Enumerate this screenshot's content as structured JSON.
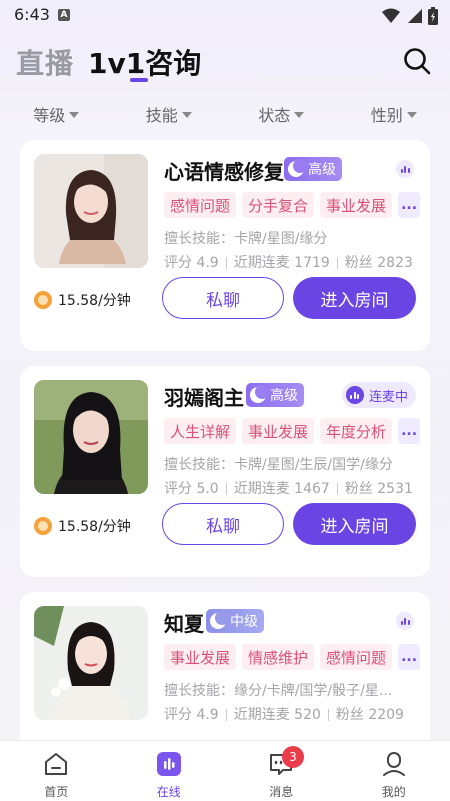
{
  "status_bar": {
    "time": "6:43",
    "notification_letter": "A"
  },
  "header": {
    "tab_live": "直播",
    "tab_1v1": "1v1咨询"
  },
  "filters": [
    {
      "label": "等级"
    },
    {
      "label": "技能"
    },
    {
      "label": "状态"
    },
    {
      "label": "性别"
    }
  ],
  "cards": [
    {
      "name": "心语情感修复",
      "level": "高级",
      "status": "idle",
      "tags": [
        "感情问题",
        "分手复合",
        "事业发展"
      ],
      "more": "...",
      "skills": "擅长技能：卡牌/星图/缘分",
      "score": "评分 4.9",
      "calls": "近期连麦 1719",
      "fans": "粉丝 2823",
      "price": "15.58/分钟",
      "chat_label": "私聊",
      "enter_label": "进入房间"
    },
    {
      "name": "羽嫣阁主",
      "level": "高级",
      "status": "live",
      "status_label": "连麦中",
      "tags": [
        "人生详解",
        "事业发展",
        "年度分析"
      ],
      "more": "...",
      "skills": "擅长技能：卡牌/星图/生辰/国学/缘分",
      "score": "评分 5.0",
      "calls": "近期连麦 1467",
      "fans": "粉丝 2531",
      "price": "15.58/分钟",
      "chat_label": "私聊",
      "enter_label": "进入房间"
    },
    {
      "name": "知夏",
      "level": "中级",
      "status": "idle",
      "tags": [
        "事业发展",
        "情感维护",
        "感情问题"
      ],
      "more": "...",
      "skills": "擅长技能：缘分/卡牌/国学/骰子/星...",
      "score": "评分 4.9",
      "calls": "近期连麦 520",
      "fans": "粉丝 2209"
    }
  ],
  "bottom_nav": [
    {
      "label": "首页",
      "icon": "home-icon"
    },
    {
      "label": "在线",
      "icon": "online-icon"
    },
    {
      "label": "消息",
      "icon": "message-icon",
      "badge": "3"
    },
    {
      "label": "我的",
      "icon": "profile-icon"
    }
  ],
  "colors": {
    "accent": "#6a45e8",
    "tag_text": "#d9527a",
    "tag_bg": "#fdeef1",
    "badge": "#ea3c4a"
  }
}
